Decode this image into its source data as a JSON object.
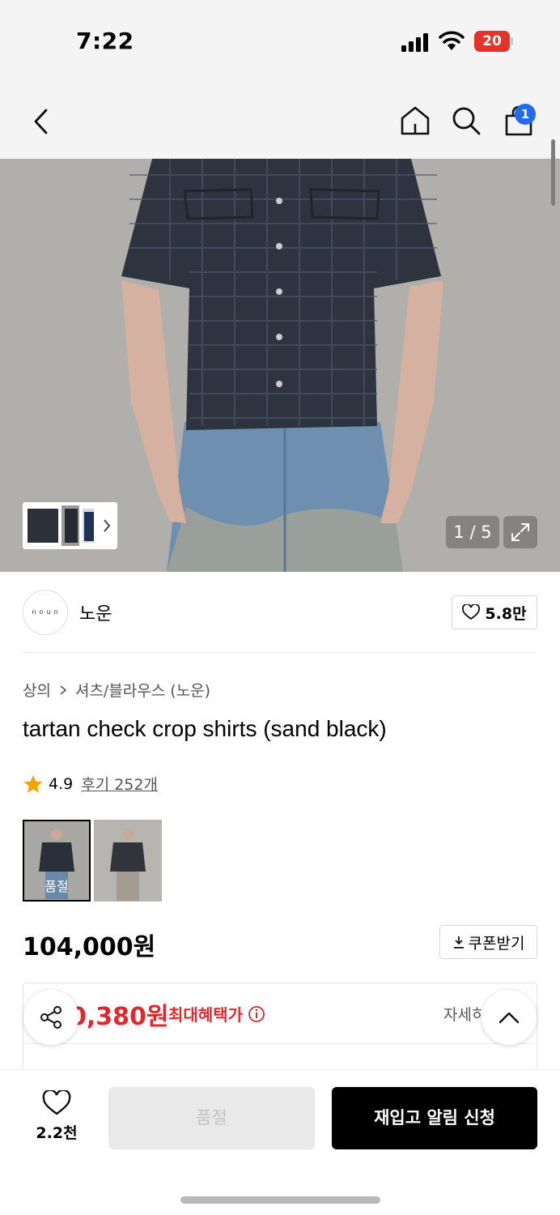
{
  "status_bar": {
    "time": "7:22",
    "battery": "20"
  },
  "nav": {
    "cart_count": "1"
  },
  "gallery": {
    "page_counter": "1 / 5"
  },
  "brand": {
    "logo_text": "noun",
    "name": "노운",
    "likes": "5.8만"
  },
  "breadcrumb": {
    "category": "상의",
    "subcategory": "셔츠/블라우스 (노운)"
  },
  "product": {
    "title": "tartan check crop shirts (sand black)",
    "rating": "4.9",
    "reviews": "후기 252개",
    "option_soldout_label": "품절",
    "price": "104,000원",
    "coupon_label": "쿠폰받기"
  },
  "benefit": {
    "price_partial": "0,380원",
    "label": "최대혜택가",
    "detail_link": "자세히"
  },
  "bottom_bar": {
    "wish_count": "2.2천",
    "soldout_button": "품절",
    "restock_button": "재입고 알림 신청"
  },
  "colors": {
    "accent_red": "#e0282e",
    "badge_blue": "#1f6cf2",
    "star": "#f4a300"
  }
}
